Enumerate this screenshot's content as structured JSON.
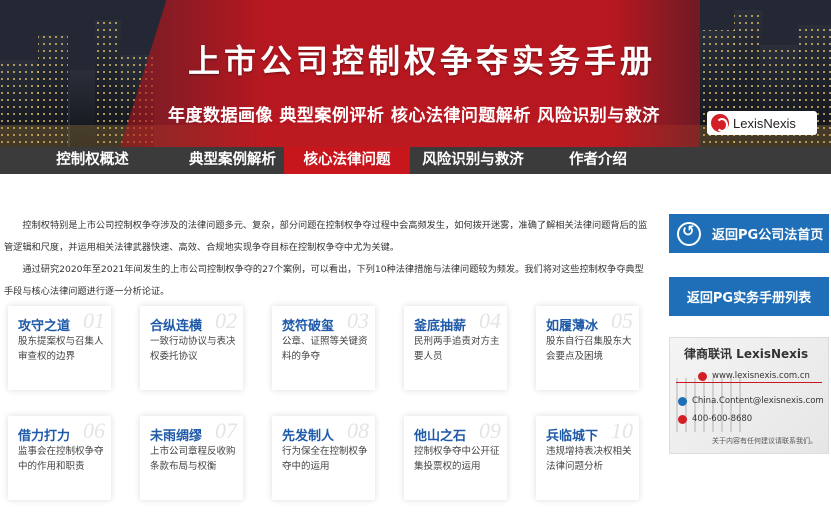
{
  "banner": {
    "title": "上市公司控制权争夺实务手册",
    "subtitle": "年度数据画像 典型案例评析 核心法律问题解析 风险识别与救济",
    "logo_text": "LexisNexis"
  },
  "nav": {
    "items": [
      {
        "label": "控制权概述"
      },
      {
        "label": "典型案例解析"
      },
      {
        "label": "核心法律问题",
        "active": true
      },
      {
        "label": "风险识别与救济"
      },
      {
        "label": "作者介绍"
      }
    ]
  },
  "intro": {
    "p1": "控制权特别是上市公司控制权争夺涉及的法律问题多元、复杂，部分问题在控制权争夺过程中会高频发生，如何拨开迷雾，准确了解相关法律问题背后的监管逻辑和尺度，并运用相关法律武器快速、高效、合规地实现争夺目标在控制权争夺中尤为关键。",
    "p2": "通过研究2020年至2021年间发生的上市公司控制权争夺的27个案例，可以看出，下列10种法律措施与法律问题较为频发。我们将对这些控制权争夺典型手段与核心法律问题进行逐一分析论证。"
  },
  "cards": [
    {
      "num": "01",
      "title": "攻守之道",
      "desc": "股东提案权与召集人审查权的边界"
    },
    {
      "num": "02",
      "title": "合纵连横",
      "desc": "一致行动协议与表决权委托协议"
    },
    {
      "num": "03",
      "title": "焚符破玺",
      "desc": "公章、证照等关键资料的争夺"
    },
    {
      "num": "04",
      "title": "釜底抽薪",
      "desc": "民刑两手追责对方主要人员"
    },
    {
      "num": "05",
      "title": "如履薄冰",
      "desc": "股东自行召集股东大会要点及困境"
    },
    {
      "num": "06",
      "title": "借力打力",
      "desc": "监事会在控制权争夺中的作用和职责"
    },
    {
      "num": "07",
      "title": "未雨绸缪",
      "desc": "上市公司章程反收购条款布局与权衡"
    },
    {
      "num": "08",
      "title": "先发制人",
      "desc": "行为保全在控制权争夺中的运用"
    },
    {
      "num": "09",
      "title": "他山之石",
      "desc": "控制权争夺中公开征集投票权的运用"
    },
    {
      "num": "10",
      "title": "兵临城下",
      "desc": "违规增持表决权相关法律问题分析"
    }
  ],
  "sidebar": {
    "home_button": "返回PG公司法首页",
    "list_button": "返回PG实务手册列表",
    "ad": {
      "heading": "律商联讯 LexisNexis",
      "website": "www.lexisnexis.com.cn",
      "email": "China.Content@lexisnexis.com",
      "phone": "400-600-8680",
      "footer": "关于内容有任何建议请联系我们。"
    }
  },
  "colors": {
    "accent_red": "#c8161d",
    "link_blue": "#1e6fb7",
    "card_title_blue": "#1f5aa8",
    "nav_bg": "#3b3b3b"
  }
}
